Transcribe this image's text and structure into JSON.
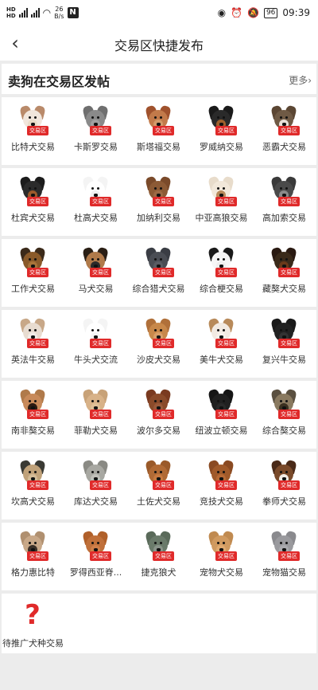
{
  "status_bar": {
    "sim1": "HD",
    "sim2": "HD",
    "net_speed": "26",
    "net_unit": "B/s",
    "battery": "96",
    "time": "09:39"
  },
  "nav": {
    "back_label": "‹",
    "title": "交易区快捷发布"
  },
  "section": {
    "title": "卖狗在交易区发帖",
    "more_label": "更多›"
  },
  "badge_label": "交易区",
  "rows": [
    [
      {
        "name": "比特犬交易",
        "colors": [
          "#b98a6a",
          "#f1e6dc",
          "#e9dcc9"
        ]
      },
      {
        "name": "卡斯罗交易",
        "colors": [
          "#6f6f6f",
          "#8a8a8a",
          "#a0a0a0"
        ]
      },
      {
        "name": "斯塔福交易",
        "colors": [
          "#a0522d",
          "#c27a4a",
          "#d29a6a"
        ]
      },
      {
        "name": "罗威纳交易",
        "colors": [
          "#1a1a1a",
          "#2a2a2a",
          "#a0612d"
        ]
      },
      {
        "name": "恶霸犬交易",
        "colors": [
          "#5b4633",
          "#6f5a45",
          "#e8e0d8"
        ]
      }
    ],
    [
      {
        "name": "杜宾犬交易",
        "colors": [
          "#1c1c1c",
          "#2b2b2b",
          "#9c5a2b"
        ]
      },
      {
        "name": "杜高犬交易",
        "colors": [
          "#f4f4f4",
          "#ffffff",
          "#f0f0f0"
        ]
      },
      {
        "name": "加纳利交易",
        "colors": [
          "#7a4a2a",
          "#8c5a35",
          "#9c6a45"
        ]
      },
      {
        "name": "中亚高狼交易",
        "colors": [
          "#e8dccb",
          "#f2e8da",
          "#b88a5a"
        ]
      },
      {
        "name": "高加索交易",
        "colors": [
          "#3a3a3a",
          "#4a4a4a",
          "#8a8a8a"
        ]
      }
    ],
    [
      {
        "name": "工作犬交易",
        "colors": [
          "#3b2a1a",
          "#8a5a2a",
          "#a8743a"
        ]
      },
      {
        "name": "马犬交易",
        "colors": [
          "#2a1f15",
          "#b07a4a",
          "#2a2a2a"
        ]
      },
      {
        "name": "综合猎犬交易",
        "colors": [
          "#3a3d44",
          "#4a4d54",
          "#5a5d64"
        ]
      },
      {
        "name": "综合梗交易",
        "colors": [
          "#1a1a1a",
          "#f6f6f6",
          "#eeeeee"
        ]
      },
      {
        "name": "藏獒犬交易",
        "colors": [
          "#2a1a12",
          "#3a2a1a",
          "#6a3a1a"
        ]
      }
    ],
    [
      {
        "name": "英法牛交易",
        "colors": [
          "#c8a888",
          "#e8dcd0",
          "#f2ece6"
        ]
      },
      {
        "name": "牛头犬交流",
        "colors": [
          "#f4f4f4",
          "#ffffff",
          "#f6f6f6"
        ]
      },
      {
        "name": "沙皮犬交易",
        "colors": [
          "#b0703a",
          "#c8884a",
          "#d8a06a"
        ]
      },
      {
        "name": "美牛犬交易",
        "colors": [
          "#b88a5a",
          "#f2eae2",
          "#f6f0ea"
        ]
      },
      {
        "name": "复兴牛交易",
        "colors": [
          "#1a1a1a",
          "#222222",
          "#333333"
        ]
      }
    ],
    [
      {
        "name": "南非獒交易",
        "colors": [
          "#b07a4a",
          "#c88a5a",
          "#2a1a12"
        ]
      },
      {
        "name": "菲勒犬交易",
        "colors": [
          "#c8a278",
          "#d8b288",
          "#e0c098"
        ]
      },
      {
        "name": "波尔多交易",
        "colors": [
          "#7a3a20",
          "#8a4a2a",
          "#9a5a3a"
        ]
      },
      {
        "name": "纽波立顿交易",
        "colors": [
          "#161616",
          "#202020",
          "#2a2a2a"
        ]
      },
      {
        "name": "综合獒交易",
        "colors": [
          "#5a5040",
          "#8a7a60",
          "#3a3020"
        ]
      }
    ],
    [
      {
        "name": "坎高犬交易",
        "colors": [
          "#3a3a34",
          "#c0a27a",
          "#d4bc98"
        ]
      },
      {
        "name": "库达犬交易",
        "colors": [
          "#8a8a84",
          "#a8a8a2",
          "#c0c0ba"
        ]
      },
      {
        "name": "土佐犬交易",
        "colors": [
          "#9a5a2a",
          "#b06a35",
          "#c87a40"
        ]
      },
      {
        "name": "竞技犬交易",
        "colors": [
          "#8a4a22",
          "#a05a2a",
          "#b86a35"
        ]
      },
      {
        "name": "拳师犬交易",
        "colors": [
          "#4a2a18",
          "#7a4a2a",
          "#f2ece6"
        ]
      }
    ],
    [
      {
        "name": "格力惠比特",
        "colors": [
          "#b09070",
          "#c8a888",
          "#3a3028"
        ]
      },
      {
        "name": "罗得西亚脊...",
        "colors": [
          "#b0602a",
          "#c0703a",
          "#d0804a"
        ]
      },
      {
        "name": "捷克狼犬",
        "colors": [
          "#5a6a5a",
          "#6a7a6a",
          "#8a948a"
        ]
      },
      {
        "name": "宠物犬交易",
        "colors": [
          "#c08a50",
          "#d09a60",
          "#e0aa70"
        ]
      },
      {
        "name": "宠物猫交易",
        "colors": [
          "#8a8a8e",
          "#9a9a9e",
          "#aaaaae"
        ]
      }
    ]
  ],
  "last_item": {
    "name": "待推广犬种交易",
    "icon": "?"
  }
}
